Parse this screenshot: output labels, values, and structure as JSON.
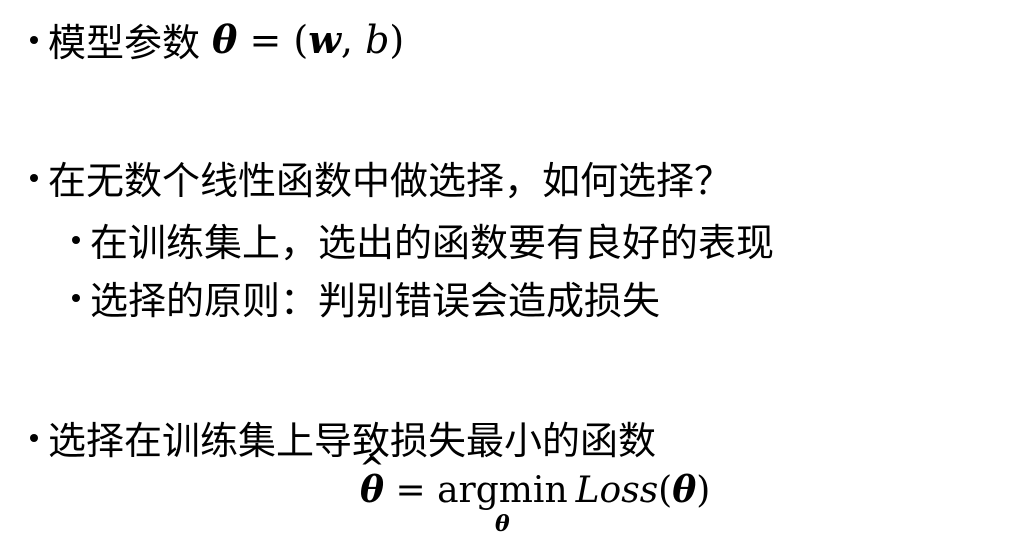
{
  "bullets": [
    {
      "text": "模型参数",
      "math": {
        "theta": "θ",
        "equals": " = ",
        "open": "(",
        "w": "w",
        "comma": ",",
        "b": " b",
        "close": ")"
      }
    },
    {
      "text": "在无数个线性函数中做选择，如何选择？"
    },
    {
      "text": "在训练集上，选出的函数要有良好的表现"
    },
    {
      "text": "选择的原则：判别错误会造成损失"
    },
    {
      "text": "选择在训练集上导致损失最小的函数"
    }
  ],
  "formula": {
    "theta_hat": "θ",
    "hat": "^",
    "equals": " = ",
    "argmin": "argmin",
    "argmin_sub": "θ",
    "loss": "Loss",
    "open": "(",
    "theta": "θ",
    "close": ")"
  }
}
